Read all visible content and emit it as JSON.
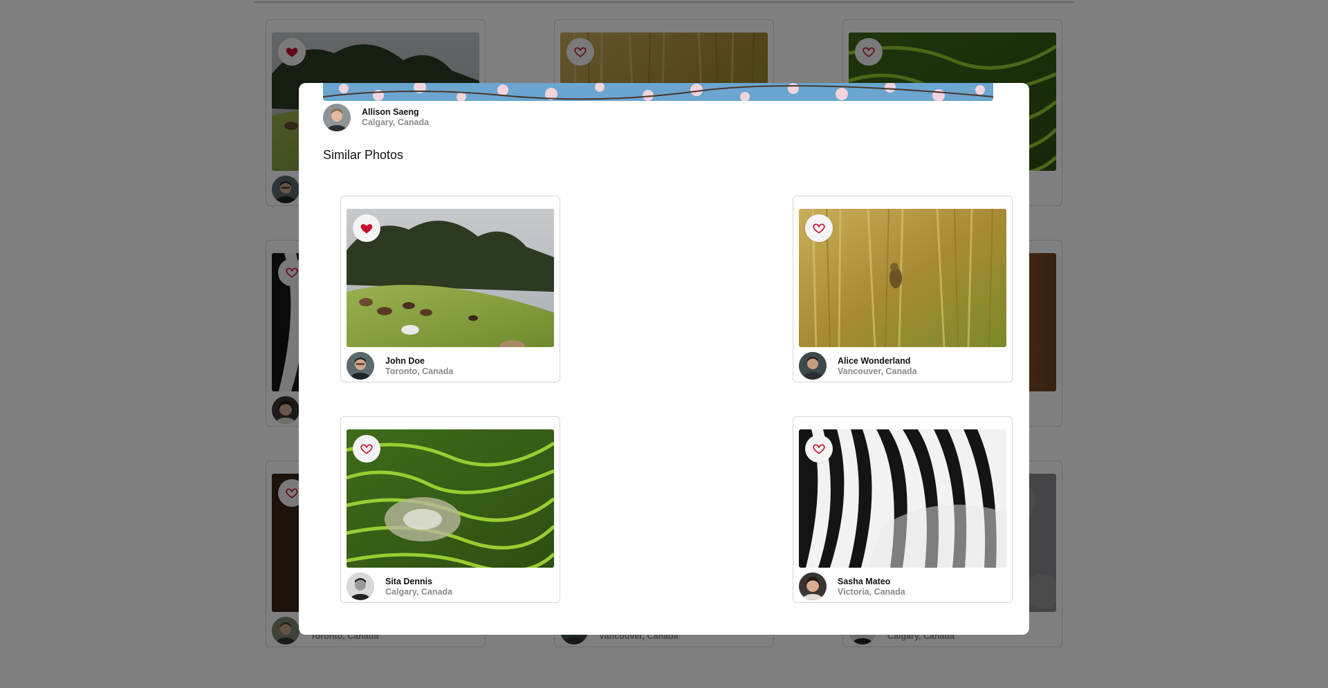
{
  "background_grid": [
    {
      "name": "",
      "location": "",
      "favorited": true,
      "photo": "horses"
    },
    {
      "name": "",
      "location": "",
      "favorited": false,
      "photo": "reeds"
    },
    {
      "name": "",
      "location": "",
      "favorited": false,
      "photo": "terraces"
    },
    {
      "name": "",
      "location": "",
      "favorited": false,
      "photo": "zebra"
    },
    {
      "name": "",
      "location": "",
      "favorited": false,
      "photo": "blank"
    },
    {
      "name": "",
      "location": "",
      "favorited": false,
      "photo": "wood"
    },
    {
      "name": "",
      "location": "Toronto, Canada",
      "favorited": false,
      "photo": "dark"
    },
    {
      "name": "",
      "location": "Vancouver, Canada",
      "favorited": false,
      "photo": "blank"
    },
    {
      "name": "",
      "location": "Calgary, Canada",
      "favorited": false,
      "photo": "stone"
    }
  ],
  "modal": {
    "photo": "cherry-blossom",
    "author": {
      "name": "Allison Saeng",
      "location": "Calgary, Canada"
    },
    "similar_title": "Similar Photos",
    "similar_photos": [
      {
        "name": "John Doe",
        "location": "Toronto, Canada",
        "favorited": true,
        "photo": "horses"
      },
      {
        "name": "Alice Wonderland",
        "location": "Vancouver, Canada",
        "favorited": false,
        "photo": "reeds"
      },
      {
        "name": "Sita Dennis",
        "location": "Calgary, Canada",
        "favorited": false,
        "photo": "terraces"
      },
      {
        "name": "Sasha Mateo",
        "location": "Victoria, Canada",
        "favorited": false,
        "photo": "zebra"
      }
    ]
  },
  "colors": {
    "heart": "#c8102e",
    "overlay": "rgba(0,0,0,0.5)"
  }
}
